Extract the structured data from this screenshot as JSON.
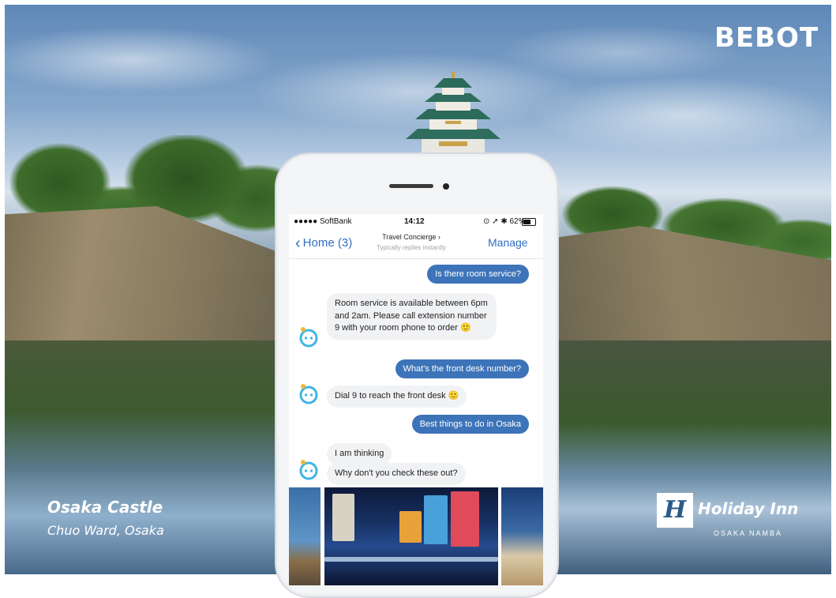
{
  "brand": {
    "bebot": "BEBOT"
  },
  "location": {
    "title": "Osaka Castle",
    "subtitle": "Chuo Ward, Osaka"
  },
  "hotel": {
    "mark": "H",
    "name": "Holiday Inn",
    "sub": "OSAKA NAMBA"
  },
  "phone": {
    "status": {
      "carrier": "●●●●● SoftBank",
      "time": "14:12",
      "right": "⊙ ➚ ✱ 62%",
      "battery_level": 0.62
    },
    "nav": {
      "back_label": "Home (3)",
      "title": "Travel Concierge ›",
      "subtitle": "Typically replies instantly",
      "manage_label": "Manage"
    },
    "messages": [
      {
        "from": "user",
        "text": "Is there room service?"
      },
      {
        "from": "bot",
        "text": "Room service is available between 6pm and 2am. Please call extension number 9 with your room phone to order 🙂"
      },
      {
        "from": "user",
        "text": "What's the front desk number?"
      },
      {
        "from": "bot",
        "text": "Dial 9 to reach the front desk 🙂"
      },
      {
        "from": "user",
        "text": "Best things to do in Osaka"
      },
      {
        "from": "bot",
        "text": "I am thinking"
      },
      {
        "from": "bot",
        "text": "Why don't you check these out?"
      }
    ]
  },
  "colors": {
    "accent": "#3d74b9",
    "link": "#2f6ec2",
    "bubble_in": "#f1f2f4",
    "bot_icon": "#3fb4e5"
  }
}
